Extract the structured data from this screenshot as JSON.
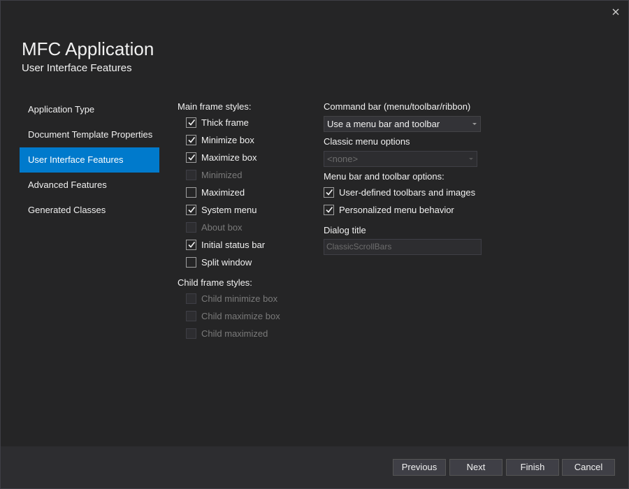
{
  "window": {
    "title": "MFC Application",
    "subtitle": "User Interface Features",
    "close_icon": "close-icon"
  },
  "nav": {
    "items": [
      {
        "label": "Application Type",
        "active": false
      },
      {
        "label": "Document Template Properties",
        "active": false
      },
      {
        "label": "User Interface Features",
        "active": true
      },
      {
        "label": "Advanced Features",
        "active": false
      },
      {
        "label": "Generated Classes",
        "active": false
      }
    ]
  },
  "main_frame": {
    "label": "Main frame styles:",
    "options": [
      {
        "label": "Thick frame",
        "checked": true,
        "enabled": true
      },
      {
        "label": "Minimize box",
        "checked": true,
        "enabled": true
      },
      {
        "label": "Maximize box",
        "checked": true,
        "enabled": true
      },
      {
        "label": "Minimized",
        "checked": false,
        "enabled": false
      },
      {
        "label": "Maximized",
        "checked": false,
        "enabled": true
      },
      {
        "label": "System menu",
        "checked": true,
        "enabled": true
      },
      {
        "label": "About box",
        "checked": false,
        "enabled": false
      },
      {
        "label": "Initial status bar",
        "checked": true,
        "enabled": true
      },
      {
        "label": "Split window",
        "checked": false,
        "enabled": true
      }
    ]
  },
  "child_frame": {
    "label": "Child frame styles:",
    "options": [
      {
        "label": "Child minimize box",
        "checked": false,
        "enabled": false
      },
      {
        "label": "Child maximize box",
        "checked": false,
        "enabled": false
      },
      {
        "label": "Child maximized",
        "checked": false,
        "enabled": false
      }
    ]
  },
  "command_bar": {
    "label": "Command bar (menu/toolbar/ribbon)",
    "value": "Use a menu bar and toolbar"
  },
  "classic_menu": {
    "label": "Classic menu options",
    "value": "<none>"
  },
  "menu_toolbar": {
    "label": "Menu bar and toolbar options:",
    "options": [
      {
        "label": "User-defined toolbars and images",
        "checked": true,
        "enabled": true
      },
      {
        "label": "Personalized menu behavior",
        "checked": true,
        "enabled": true
      }
    ]
  },
  "dialog_title": {
    "label": "Dialog title",
    "value": "ClassicScrollBars"
  },
  "footer": {
    "previous": "Previous",
    "next": "Next",
    "finish": "Finish",
    "cancel": "Cancel"
  },
  "colors": {
    "background": "#252526",
    "accent": "#007acc",
    "footer": "#2d2d30",
    "text": "#f1f1f1",
    "disabled_text": "#7a7a7a"
  }
}
